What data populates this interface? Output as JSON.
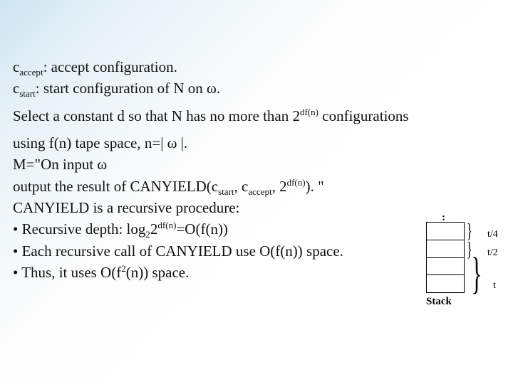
{
  "lines": {
    "l1a": "c",
    "l1b": "accept",
    "l1c": ": accept configuration.",
    "l2a": "c",
    "l2b": "start",
    "l2c": ": start configuration of N on ω.",
    "l3a": "Select a constant d so that N has no more than 2",
    "l3b": "df(n)",
    "l3c": " configurations",
    "l4": "using f(n) tape space, n=| ω |.",
    "l5": "M=\"On input ω",
    "l6a": "output the result of CANYIELD(c",
    "l6b": "start",
    "l6c": ", c",
    "l6d": "accept",
    "l6e": ", 2",
    "l6f": "df(n)",
    "l6g": "). \"",
    "l7": "CANYIELD is a recursive procedure:",
    "l8a": "• Recursive depth: log",
    "l8b": "2",
    "l8c": "2",
    "l8d": "df(n)",
    "l8e": "=O(f(n))",
    "l9": "• Each recursive call of CANYIELD use O(f(n)) space.",
    "l10a": "• Thus, it uses O(f",
    "l10b": "2",
    "l10c": "(n)) space."
  },
  "figure": {
    "dots": ":",
    "t4": "t/4",
    "t2": "t/2",
    "t": "t",
    "stack": "Stack"
  }
}
